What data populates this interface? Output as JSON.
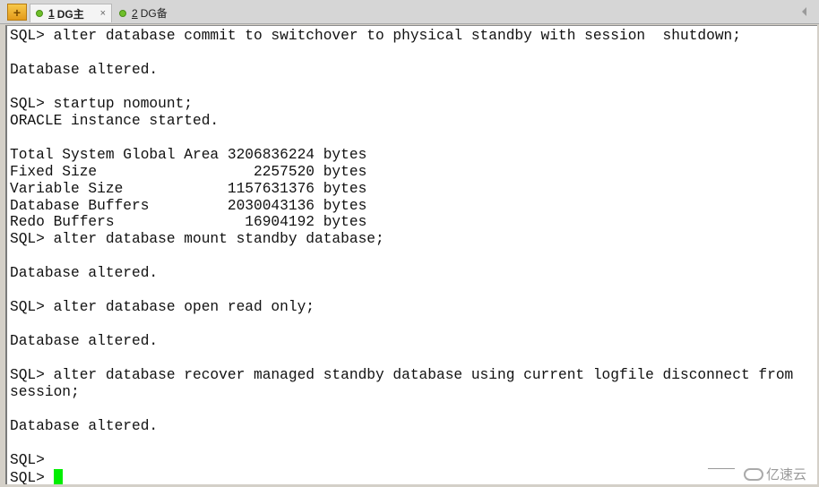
{
  "tabbar": {
    "add_button_icon": "+",
    "tabs": [
      {
        "number": "1",
        "label": "DG主",
        "active": true,
        "status_color": "#6fbf2a",
        "close_icon": "×"
      },
      {
        "number": "2",
        "label": "DG备",
        "active": false,
        "status_color": "#6fbf2a"
      }
    ]
  },
  "terminal": {
    "lines": [
      "SQL> alter database commit to switchover to physical standby with session  shutdown;",
      "",
      "Database altered.",
      "",
      "SQL> startup nomount;",
      "ORACLE instance started.",
      "",
      "Total System Global Area 3206836224 bytes",
      "Fixed Size                  2257520 bytes",
      "Variable Size            1157631376 bytes",
      "Database Buffers         2030043136 bytes",
      "Redo Buffers               16904192 bytes",
      "SQL> alter database mount standby database;",
      "",
      "Database altered.",
      "",
      "SQL> alter database open read only;",
      "",
      "Database altered.",
      "",
      "SQL> alter database recover managed standby database using current logfile disconnect from",
      "session;",
      "",
      "Database altered.",
      "",
      "SQL>"
    ],
    "prompt": "SQL> ",
    "cursor_color": "#00ee00"
  },
  "watermark": {
    "text": "亿速云"
  }
}
